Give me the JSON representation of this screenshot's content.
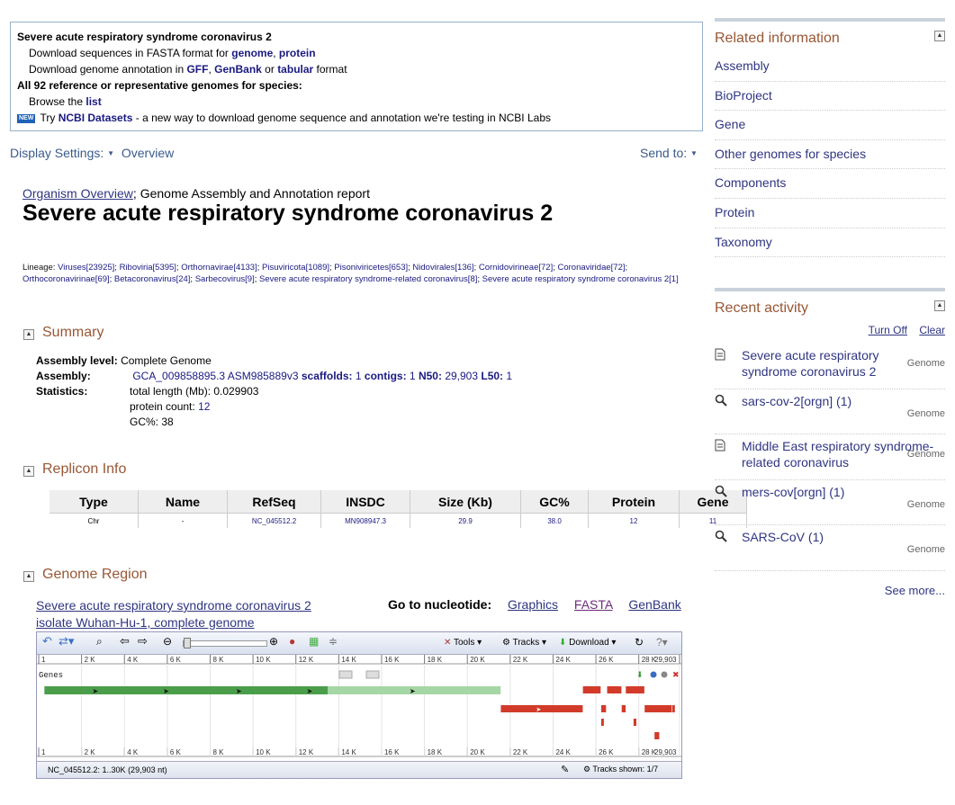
{
  "topbox": {
    "title": "Severe acute respiratory syndrome coronavirus 2",
    "line1_prefix": "Download sequences in FASTA format for",
    "line1_link1": "genome",
    "line1_link2": "protein",
    "line2_prefix": "Download genome annotation in",
    "line2_link1": "GFF",
    "line2_link2": "GenBank",
    "line2_mid": "or",
    "line2_link3": "tabular",
    "line2_suffix": "format",
    "line3": "All 92 reference or representative genomes for species:",
    "line4_prefix": "Browse the",
    "line4_link": "list",
    "new_badge": "NEW",
    "line5_prefix": "Try",
    "line5_link": "NCBI Datasets",
    "line5_suffix": "- a new way to download genome sequence and annotation we're testing in NCBI Labs"
  },
  "display": {
    "settings": "Display Settings:",
    "overview": "Overview",
    "send_to": "Send to:"
  },
  "crumb": {
    "link": "Organism Overview",
    "sep": ";",
    "current": "Genome Assembly and Annotation report"
  },
  "title": "Severe acute respiratory syndrome coronavirus 2",
  "lineage": {
    "label": "Lineage:",
    "items": [
      "Viruses[23925]",
      "Riboviria[5395]",
      "Orthornavirae[4133]",
      "Pisuviricota[1089]",
      "Pisoniviricetes[653]",
      "Nidovirales[136]",
      "Cornidovirineae[72]",
      "Coronaviridae[72]",
      "Orthocoronavirinae[69]",
      "Betacoronavirus[24]",
      "Sarbecovirus[9]",
      "Severe acute respiratory syndrome-related coronavirus[8]",
      "Severe acute respiratory syndrome coronavirus 2[1]"
    ]
  },
  "summary": {
    "heading": "Summary",
    "level_label": "Assembly level:",
    "level_value": "Complete Genome",
    "assembly_label": "Assembly:",
    "assembly_value": "GCA_009858895.3 ASM985889v3",
    "scaffolds_label": "scaffolds:",
    "scaffolds_value": "1",
    "contigs_label": "contigs:",
    "contigs_value": "1",
    "n50_label": "N50:",
    "n50_value": "29,903",
    "l50_label": "L50:",
    "l50_value": "1",
    "stats_label": "Statistics:",
    "total_length": "total length (Mb): 0.029903",
    "protein_label": "protein count:",
    "protein_value": "12",
    "gc": "GC%: 38"
  },
  "replicon": {
    "heading": "Replicon Info",
    "columns": [
      "Type",
      "Name",
      "RefSeq",
      "INSDC",
      "Size (Kb)",
      "GC%",
      "Protein",
      "Gene"
    ],
    "row": [
      "Chr",
      "-",
      "NC_045512.2",
      "MN908947.3",
      "29.9",
      "38.0",
      "12",
      "11"
    ]
  },
  "region": {
    "heading": "Genome Region",
    "link_line1": "Severe acute respiratory syndrome coronavirus 2",
    "link_line2": "isolate Wuhan-Hu-1, complete genome",
    "goto_label": "Go to nucleotide:",
    "goto_links": [
      "Graphics",
      "FASTA",
      "GenBank"
    ]
  },
  "viewer": {
    "tools": "Tools",
    "tracks": "Tracks",
    "download": "Download",
    "ruler_ticks": [
      "1",
      "2 K",
      "4 K",
      "6 K",
      "8 K",
      "10 K",
      "12 K",
      "14 K",
      "16 K",
      "18 K",
      "20 K",
      "22 K",
      "24 K",
      "26 K",
      "28 K",
      "29,903"
    ],
    "track_label": "Genes",
    "footer_seq": "NC_045512.2: 1..30K (29,903 nt)",
    "footer_tracks": "Tracks shown: 1/7"
  },
  "related": {
    "heading": "Related information",
    "links": [
      "Assembly",
      "BioProject",
      "Gene",
      "Other genomes for species",
      "Components",
      "Protein",
      "Taxonomy"
    ]
  },
  "recent": {
    "heading": "Recent activity",
    "turn_off": "Turn Off",
    "clear": "Clear",
    "items": [
      {
        "icon": "document-icon",
        "line1": "Severe acute respiratory",
        "line2": "syndrome coronavirus 2",
        "db": "Genome"
      },
      {
        "icon": "search-icon",
        "line1": "sars-cov-2[orgn] (1)",
        "line2": "",
        "db": "Genome"
      },
      {
        "icon": "document-icon",
        "line1": "Middle East respiratory syndrome-",
        "line2": "related coronavirus",
        "db": "Genome"
      },
      {
        "icon": "search-icon",
        "line1": "mers-cov[orgn] (1)",
        "line2": "",
        "db": "Genome"
      },
      {
        "icon": "search-icon",
        "line1": "SARS-CoV (1)",
        "line2": "",
        "db": "Genome"
      }
    ],
    "see_more": "See more..."
  }
}
